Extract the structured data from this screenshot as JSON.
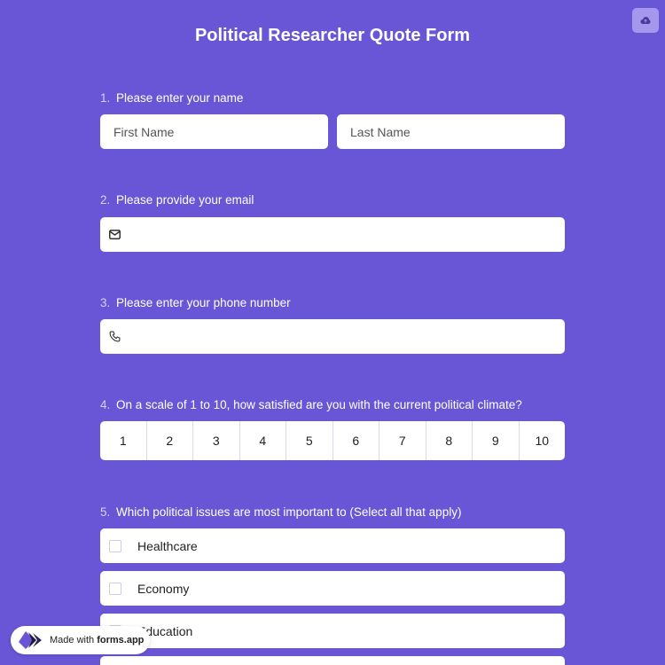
{
  "form": {
    "title": "Political Researcher Quote Form"
  },
  "header": {
    "cloud_icon": "cloud-upload-icon"
  },
  "questions": [
    {
      "number": "1.",
      "label": "Please enter your name"
    },
    {
      "number": "2.",
      "label": "Please provide your email"
    },
    {
      "number": "3.",
      "label": "Please enter your phone number"
    },
    {
      "number": "4.",
      "label": "On a scale of 1 to 10, how satisfied are you with the current political climate?"
    },
    {
      "number": "5.",
      "label": "Which political issues are most important to (Select all that apply)"
    }
  ],
  "name_fields": {
    "first_placeholder": "First Name",
    "last_placeholder": "Last Name"
  },
  "email_field": {
    "icon": "envelope-icon",
    "value": ""
  },
  "phone_field": {
    "icon": "phone-icon",
    "value": ""
  },
  "scale": [
    "1",
    "2",
    "3",
    "4",
    "5",
    "6",
    "7",
    "8",
    "9",
    "10"
  ],
  "options": [
    {
      "label": "Healthcare",
      "checked": false
    },
    {
      "label": "Economy",
      "checked": false
    },
    {
      "label": "Education",
      "checked": false
    }
  ],
  "badge": {
    "prefix": "Made with",
    "brand": "forms.app"
  },
  "colors": {
    "background": "#6956d6",
    "field": "#ffffff",
    "accent_button": "#a598ec"
  }
}
